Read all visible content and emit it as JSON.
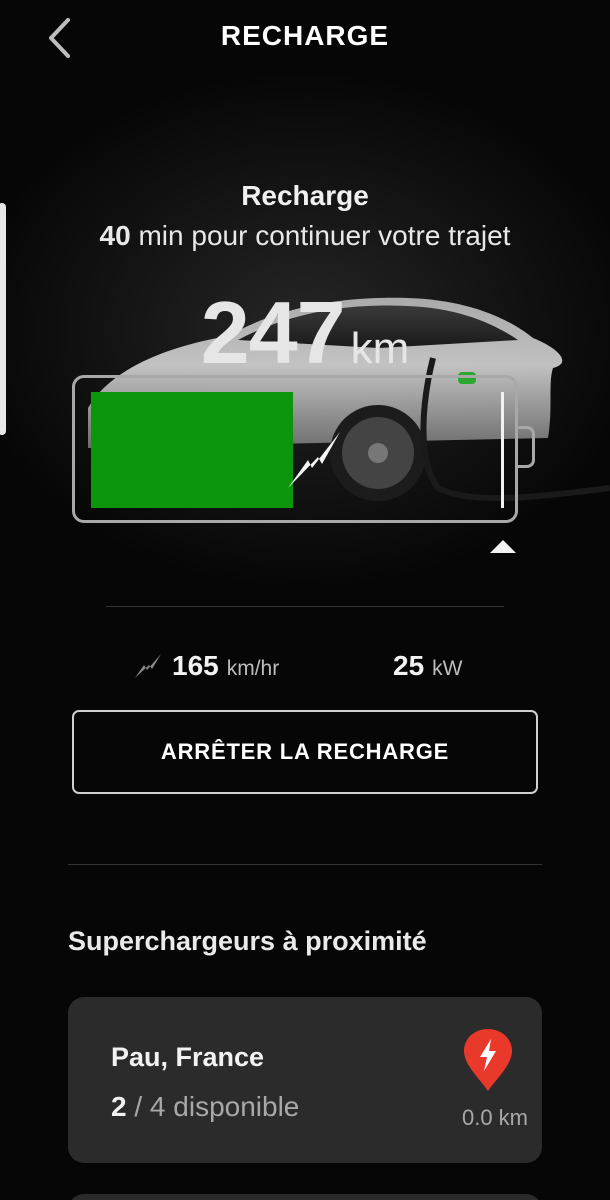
{
  "header": {
    "title": "RECHARGE"
  },
  "status": {
    "title": "Recharge",
    "minutes": "40",
    "subtitle_rest": "min pour continuer votre trajet"
  },
  "range": {
    "value": "247",
    "unit": "km"
  },
  "battery": {
    "charge_fraction": 0.49,
    "limit_fraction": 1.0,
    "fill_color": "#0c960c",
    "icon": "charging-bolt-icon"
  },
  "stats": {
    "speed_value": "165",
    "speed_unit": "km/hr",
    "speed_icon": "charge-rate-icon",
    "power_value": "25",
    "power_unit": "kW"
  },
  "actions": {
    "stop_label": "ARRÊTER LA RECHARGE"
  },
  "superchargers": {
    "title": "Superchargeurs à proximité",
    "items": [
      {
        "name": "Pau, France",
        "available": "2",
        "total_text": "/ 4 disponible",
        "distance": "0.0 km",
        "pin_color": "#e8392b",
        "icon": "supercharger-pin-icon"
      }
    ]
  }
}
